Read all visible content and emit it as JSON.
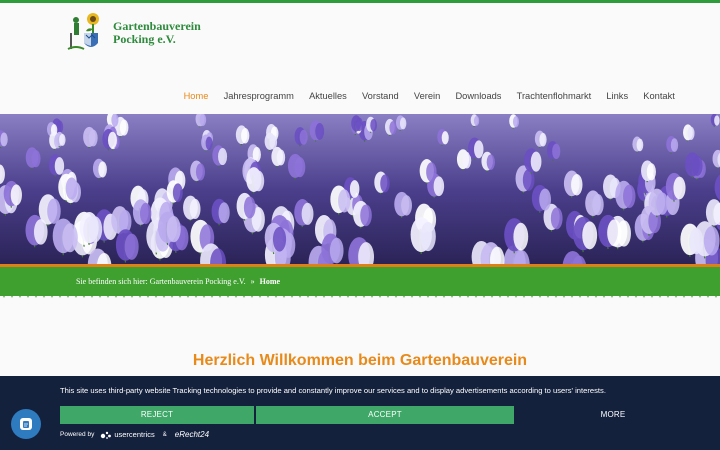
{
  "brand": {
    "line1": "Gartenbauverein",
    "line2": "Pocking e.V."
  },
  "nav": {
    "items": [
      "Home",
      "Jahresprogramm",
      "Aktuelles",
      "Vorstand",
      "Verein",
      "Downloads",
      "Trachtenflohmarkt",
      "Links",
      "Kontakt"
    ],
    "active": "Home"
  },
  "breadcrumb": {
    "prefix": "Sie befinden sich hier:",
    "parent": "Gartenbauverein Pocking e.V.",
    "separator": "»",
    "current": "Home"
  },
  "welcome": {
    "title": "Herzlich Willkommen beim Gartenbauverein"
  },
  "consent": {
    "text": "This site uses third-party website Tracking technologies to provide and constantly improve our services and to display advertisements according to users' interests.",
    "reject_label": "REJECT",
    "accept_label": "ACCEPT",
    "more_label": "MORE",
    "powered_by": "Powered by",
    "provider1": "usercentrics",
    "amp": "&",
    "provider2": "eRecht24"
  },
  "colors": {
    "accent_green": "#2e9c3a",
    "accent_orange": "#e88a1a",
    "consent_bg": "#14213d",
    "button_green": "#3fa767",
    "fab_blue": "#2f7bc0"
  },
  "icons": {
    "logo": "sunflower-gardener-crest-icon",
    "consent_fab": "cookie-settings-icon"
  }
}
